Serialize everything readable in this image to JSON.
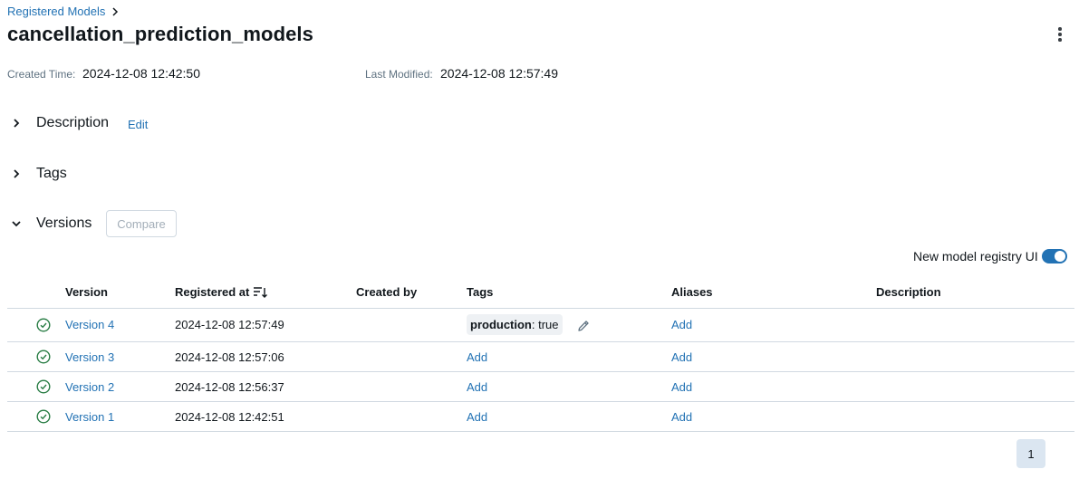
{
  "breadcrumb": {
    "link": "Registered Models",
    "separator_icon": "chevron-right-icon"
  },
  "page": {
    "title": "cancellation_prediction_models",
    "menu_icon": "kebab-menu-icon"
  },
  "meta": {
    "created_label": "Created Time:",
    "created_value": "2024-12-08 12:42:50",
    "modified_label": "Last Modified:",
    "modified_value": "2024-12-08 12:57:49"
  },
  "sections": {
    "description": {
      "label": "Description",
      "edit": "Edit",
      "expanded": false
    },
    "tags": {
      "label": "Tags",
      "expanded": false
    },
    "versions": {
      "label": "Versions",
      "compare": "Compare",
      "expanded": true
    }
  },
  "registry_toggle": {
    "label": "New model registry UI",
    "on": true
  },
  "table": {
    "columns": [
      "Version",
      "Registered at",
      "Created by",
      "Tags",
      "Aliases",
      "Description"
    ],
    "sort_icon": "sort-descending-icon",
    "rows": [
      {
        "status_icon": "check-circle-icon",
        "version": "Version 4",
        "registered_at": "2024-12-08 12:57:49",
        "created_by": "",
        "tag_key": "production",
        "tag_value": ": true",
        "tags_add": "",
        "aliases": "Add",
        "description": ""
      },
      {
        "status_icon": "check-circle-icon",
        "version": "Version 3",
        "registered_at": "2024-12-08 12:57:06",
        "created_by": "",
        "tag_key": "",
        "tag_value": "",
        "tags_add": "Add",
        "aliases": "Add",
        "description": ""
      },
      {
        "status_icon": "check-circle-icon",
        "version": "Version 2",
        "registered_at": "2024-12-08 12:56:37",
        "created_by": "",
        "tag_key": "",
        "tag_value": "",
        "tags_add": "Add",
        "aliases": "Add",
        "description": ""
      },
      {
        "status_icon": "check-circle-icon",
        "version": "Version 1",
        "registered_at": "2024-12-08 12:42:51",
        "created_by": "",
        "tag_key": "",
        "tag_value": "",
        "tags_add": "Add",
        "aliases": "Add",
        "description": ""
      }
    ]
  },
  "pagination": {
    "current_page": "1"
  },
  "colors": {
    "link": "#2272b4",
    "status_ok": "#277c43",
    "border": "#d1d9e1",
    "toggle_on": "#2272b4"
  }
}
